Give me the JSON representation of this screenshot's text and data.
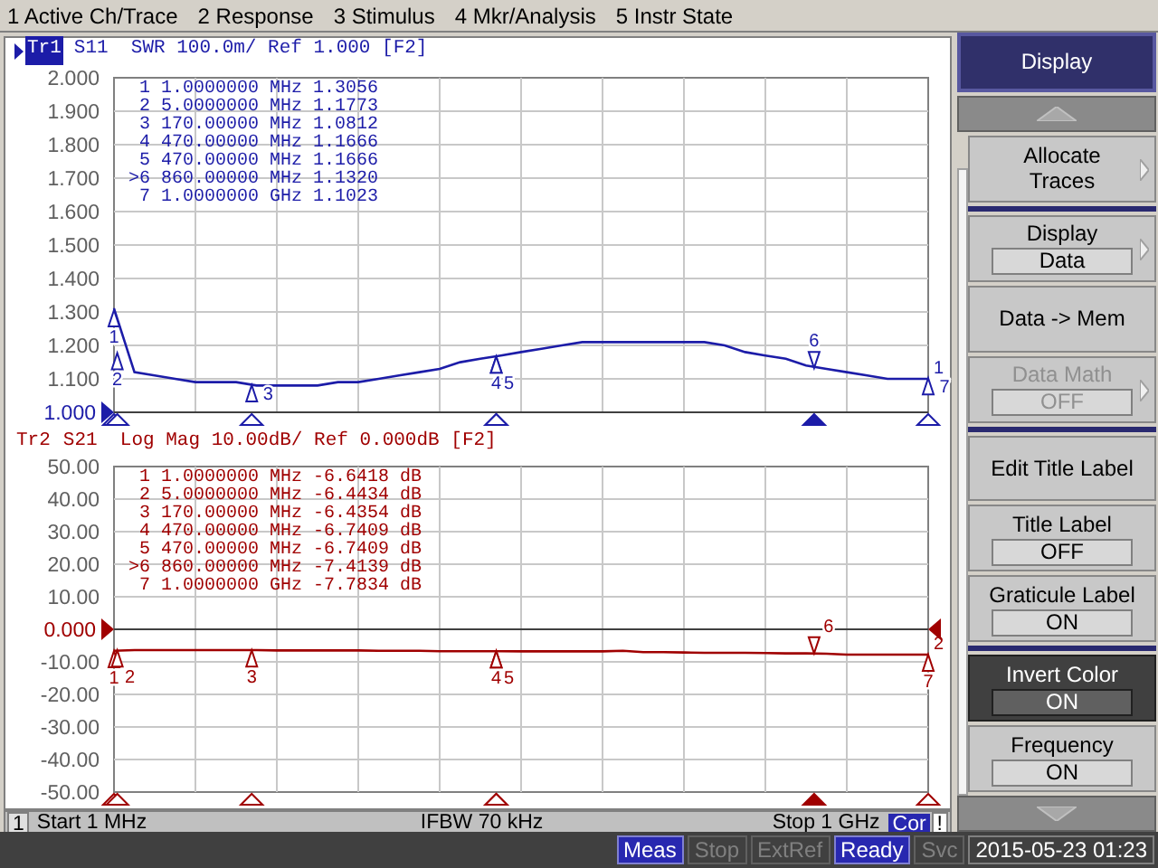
{
  "menu_bar": [
    "1 Active Ch/Trace",
    "2 Response",
    "3 Stimulus",
    "4 Mkr/Analysis",
    "5 Instr State"
  ],
  "traces": [
    {
      "name": "Tr1",
      "selected": true,
      "header": "S11  SWR 100.0m/ Ref 1.000 [F2]",
      "color": "#1c1ca8",
      "end_label": "1",
      "reference_at_bottom": true,
      "markers": [
        {
          "number": "1",
          "stimulus": "1.0000000 MHz",
          "response": "1.3056",
          "selected": false,
          "plot_label": "1"
        },
        {
          "number": "2",
          "stimulus": "5.0000000 MHz",
          "response": "1.1773",
          "selected": false,
          "plot_label": "2"
        },
        {
          "number": "3",
          "stimulus": "170.00000 MHz",
          "response": "1.0812",
          "selected": false,
          "plot_label": "3"
        },
        {
          "number": "4",
          "stimulus": "470.00000 MHz",
          "response": "1.1666",
          "selected": false,
          "plot_label": "4"
        },
        {
          "number": "5",
          "stimulus": "470.00000 MHz",
          "response": "1.1666",
          "selected": false,
          "plot_label": "5"
        },
        {
          "number": ">6",
          "stimulus": "860.00000 MHz",
          "response": "1.1320",
          "selected": true,
          "plot_label": "6"
        },
        {
          "number": "7",
          "stimulus": "1.0000000 GHz",
          "response": "1.1023",
          "selected": false,
          "plot_label": "7"
        }
      ],
      "chart_data": {
        "type": "line",
        "ylim": [
          1,
          2
        ],
        "yticks": [
          {
            "value": 2,
            "label": "2.000"
          },
          {
            "value": 1.9,
            "label": "1.900"
          },
          {
            "value": 1.8,
            "label": "1.800"
          },
          {
            "value": 1.7,
            "label": "1.700"
          },
          {
            "value": 1.6,
            "label": "1.600"
          },
          {
            "value": 1.5,
            "label": "1.500"
          },
          {
            "value": 1.4,
            "label": "1.400"
          },
          {
            "value": 1.3,
            "label": "1.300"
          },
          {
            "value": 1.2,
            "label": "1.200"
          },
          {
            "value": 1.1,
            "label": "1.100"
          },
          {
            "value": 1,
            "label": "1.000"
          }
        ],
        "grid": true,
        "categories": [
          null,
          null,
          null,
          null,
          null,
          null,
          null,
          null,
          null,
          null,
          null,
          null,
          null,
          null,
          null,
          null,
          null,
          null,
          null,
          null,
          null,
          null,
          null,
          null,
          null,
          null,
          null,
          null,
          null,
          null,
          null,
          null,
          null,
          null,
          null,
          null,
          null,
          null,
          null,
          null,
          null
        ],
        "series": [
          {
            "values": [
              1.31,
              1.12,
              1.11,
              1.1,
              1.09,
              1.09,
              1.09,
              1.08,
              1.08,
              1.08,
              1.08,
              1.09,
              1.09,
              1.1,
              1.11,
              1.12,
              1.13,
              1.15,
              1.16,
              1.17,
              1.18,
              1.19,
              1.2,
              1.21,
              1.21,
              1.21,
              1.21,
              1.21,
              1.21,
              1.21,
              1.2,
              1.18,
              1.17,
              1.16,
              1.14,
              1.13,
              1.12,
              1.11,
              1.1,
              1.1,
              1.1
            ]
          }
        ]
      }
    },
    {
      "name": "Tr2",
      "selected": false,
      "header": "S21  Log Mag 10.00dB/ Ref 0.000dB [F2]",
      "color": "#a00000",
      "end_label": "2",
      "reference_at_bottom": false,
      "markers": [
        {
          "number": "1",
          "stimulus": "1.0000000 MHz",
          "response": "-6.6418 dB",
          "selected": false,
          "plot_label": "1"
        },
        {
          "number": "2",
          "stimulus": "5.0000000 MHz",
          "response": "-6.4434 dB",
          "selected": false,
          "plot_label": "2"
        },
        {
          "number": "3",
          "stimulus": "170.00000 MHz",
          "response": "-6.4354 dB",
          "selected": false,
          "plot_label": "3"
        },
        {
          "number": "4",
          "stimulus": "470.00000 MHz",
          "response": "-6.7409 dB",
          "selected": false,
          "plot_label": "4"
        },
        {
          "number": "5",
          "stimulus": "470.00000 MHz",
          "response": "-6.7409 dB",
          "selected": false,
          "plot_label": "5"
        },
        {
          "number": ">6",
          "stimulus": "860.00000 MHz",
          "response": "-7.4139 dB",
          "selected": true,
          "plot_label": "6"
        },
        {
          "number": "7",
          "stimulus": "1.0000000 GHz",
          "response": "-7.7834 dB",
          "selected": false,
          "plot_label": "7"
        }
      ],
      "chart_data": {
        "type": "line",
        "ylim": [
          -50,
          50
        ],
        "yticks": [
          {
            "value": 50,
            "label": "50.00"
          },
          {
            "value": 40,
            "label": "40.00"
          },
          {
            "value": 30,
            "label": "30.00"
          },
          {
            "value": 20,
            "label": "20.00"
          },
          {
            "value": 10,
            "label": "10.00"
          },
          {
            "value": 0,
            "label": "0.000"
          },
          {
            "value": -10,
            "label": "-10.00"
          },
          {
            "value": -20,
            "label": "-20.00"
          },
          {
            "value": -30,
            "label": "-30.00"
          },
          {
            "value": -40,
            "label": "-40.00"
          },
          {
            "value": -50,
            "label": "-50.00"
          }
        ],
        "grid": true,
        "categories": [
          null,
          null,
          null,
          null,
          null,
          null,
          null,
          null,
          null,
          null,
          null,
          null,
          null,
          null,
          null,
          null,
          null,
          null,
          null,
          null,
          null,
          null,
          null,
          null,
          null,
          null,
          null,
          null,
          null,
          null,
          null,
          null,
          null,
          null,
          null,
          null,
          null,
          null,
          null,
          null,
          null
        ],
        "series": [
          {
            "values": [
              -6.6,
              -6.4,
              -6.4,
              -6.4,
              -6.4,
              -6.4,
              -6.4,
              -6.4,
              -6.5,
              -6.5,
              -6.5,
              -6.5,
              -6.5,
              -6.6,
              -6.6,
              -6.6,
              -6.7,
              -6.7,
              -6.7,
              -6.7,
              -6.8,
              -6.8,
              -6.8,
              -6.8,
              -6.8,
              -6.6,
              -7.0,
              -7.0,
              -7.1,
              -7.2,
              -7.2,
              -7.2,
              -7.3,
              -7.4,
              -7.4,
              -7.5,
              -7.8,
              -7.8,
              -7.8,
              -7.8,
              -7.8
            ]
          }
        ]
      }
    }
  ],
  "channel_bar": {
    "channel": "1",
    "start": "Start 1 MHz",
    "ifbw": "IFBW 70 kHz",
    "stop": "Stop 1 GHz",
    "indicators": [
      {
        "label": "Cor",
        "on": true
      },
      {
        "label": "!",
        "on": false
      }
    ]
  },
  "softkeys": {
    "title": "Display",
    "items": [
      {
        "kind": "button",
        "label": "Allocate Traces",
        "submenu": true,
        "disabled": false,
        "selected": false,
        "group_end": true
      },
      {
        "kind": "value",
        "label": "Display",
        "value": "Data",
        "submenu": true,
        "disabled": false,
        "selected": false,
        "group_end": false
      },
      {
        "kind": "button",
        "label": "Data -> Mem",
        "submenu": false,
        "disabled": false,
        "selected": false,
        "group_end": false
      },
      {
        "kind": "value",
        "label": "Data Math",
        "value": "OFF",
        "submenu": true,
        "disabled": true,
        "selected": false,
        "group_end": true
      },
      {
        "kind": "button",
        "label": "Edit Title Label",
        "submenu": false,
        "disabled": false,
        "selected": false,
        "group_end": false
      },
      {
        "kind": "value",
        "label": "Title Label",
        "value": "OFF",
        "submenu": false,
        "disabled": false,
        "selected": false,
        "group_end": false
      },
      {
        "kind": "value",
        "label": "Graticule Label",
        "value": "ON",
        "submenu": false,
        "disabled": false,
        "selected": false,
        "group_end": true
      },
      {
        "kind": "value",
        "label": "Invert Color",
        "value": "ON",
        "submenu": false,
        "disabled": false,
        "selected": true,
        "group_end": false
      },
      {
        "kind": "value",
        "label": "Frequency",
        "value": "ON",
        "submenu": false,
        "disabled": false,
        "selected": false,
        "group_end": false
      }
    ]
  },
  "status_bar": {
    "items": [
      {
        "label": "Meas",
        "on": true
      },
      {
        "label": "Stop",
        "on": false
      },
      {
        "label": "ExtRef",
        "on": false
      },
      {
        "label": "Ready",
        "on": true
      },
      {
        "label": "Svc",
        "on": false
      }
    ],
    "datetime": "2015-05-23 01:23"
  }
}
